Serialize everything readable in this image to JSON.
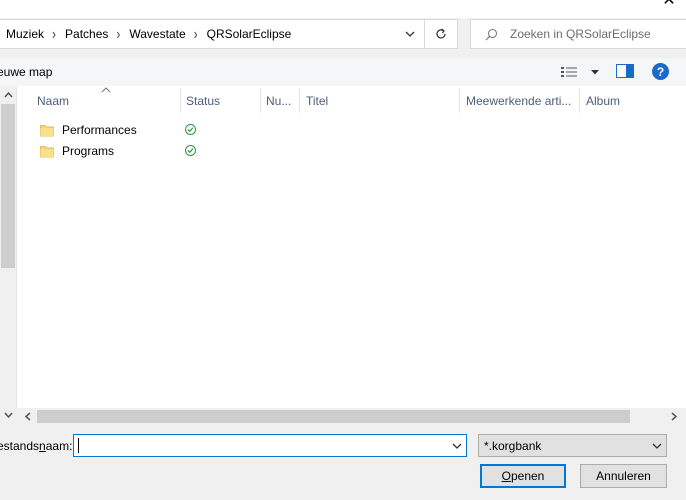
{
  "breadcrumbs": [
    "Muziek",
    "Patches",
    "Wavestate",
    "QRSolarEclipse"
  ],
  "search": {
    "placeholder": "Zoeken in QRSolarEclipse"
  },
  "toolbar": {
    "new_folder_label": "euwe map"
  },
  "columns": [
    {
      "label": "Naam"
    },
    {
      "label": "Status"
    },
    {
      "label": "Nu..."
    },
    {
      "label": "Titel"
    },
    {
      "label": "Meewerkende arti..."
    },
    {
      "label": "Album"
    }
  ],
  "files": [
    {
      "name": "Performances",
      "status": "synced"
    },
    {
      "name": "Programs",
      "status": "synced"
    }
  ],
  "filename": {
    "label_prefix": "estands",
    "label_accel": "n",
    "label_suffix": "aam:",
    "value": ""
  },
  "filetype": {
    "selected": "*.korgbank"
  },
  "buttons": {
    "open_accel": "O",
    "open_rest": "penen",
    "cancel_label": "Annuleren"
  },
  "colors": {
    "accent": "#0078d7",
    "help": "#1b6ac9",
    "folder": "#f8d775",
    "status_ok": "#2a9a3e",
    "header_text": "#4c607a"
  }
}
